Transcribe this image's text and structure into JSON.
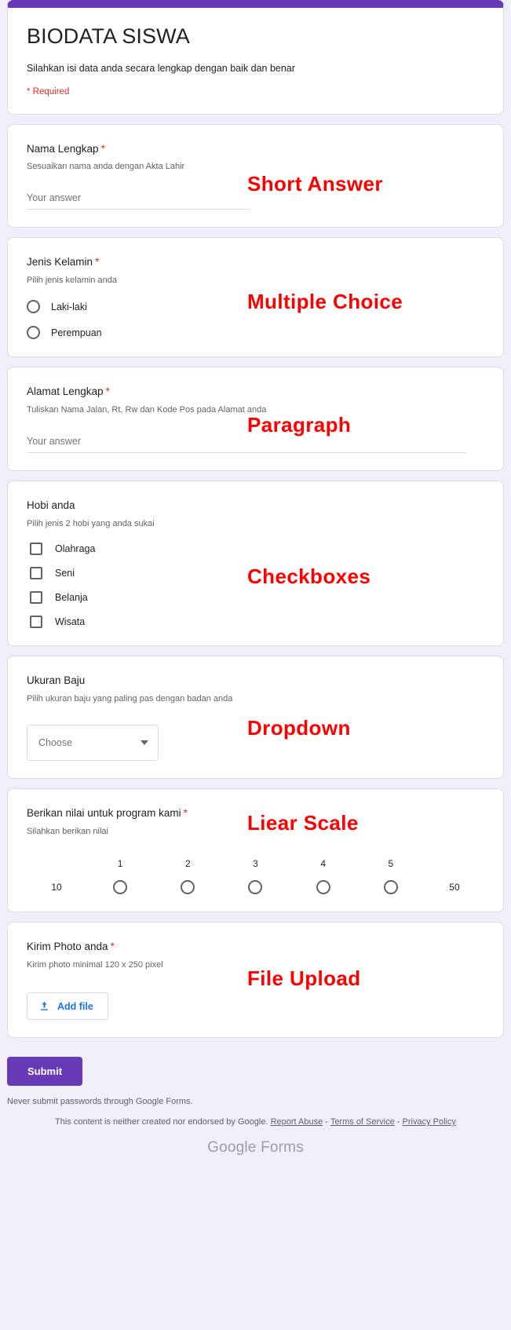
{
  "theme": {
    "accent": "#673ab7",
    "page_background": "#f0eef8",
    "card_background": "#ffffff",
    "required_red": "#d93025",
    "annotation_red": "#ff0000",
    "link_blue": "#1a73e8"
  },
  "header": {
    "title": "BIODATA SISWA",
    "description": "Silahkan isi data anda secara lengkap dengan baik dan benar",
    "required_note": "* Required"
  },
  "questions": [
    {
      "id": "nama-lengkap",
      "title": "Nama Lengkap",
      "required_mark": "*",
      "description": "Sesuaikan nama anda dengan Akta Lahir",
      "placeholder": "Your answer",
      "annotation": "Short Answer"
    },
    {
      "id": "jenis-kelamin",
      "title": "Jenis Kelamin",
      "required_mark": "*",
      "description": "Pilih jenis kelamin anda",
      "options": [
        "Laki-laki",
        "Perempuan"
      ],
      "annotation": "Multiple Choice"
    },
    {
      "id": "alamat-lengkap",
      "title": "Alamat Lengkap",
      "required_mark": "*",
      "description": "Tuliskan Nama Jalan, Rt, Rw dan Kode Pos pada Alamat anda",
      "placeholder": "Your answer",
      "annotation": "Paragraph"
    },
    {
      "id": "hobi-anda",
      "title": "Hobi anda",
      "required_mark": "",
      "description": "Pilih jenis 2 hobi yang anda sukai",
      "options": [
        "Olahraga",
        "Seni",
        "Belanja",
        "Wisata"
      ],
      "annotation": "Checkboxes"
    },
    {
      "id": "ukuran-baju",
      "title": "Ukuran Baju",
      "required_mark": "",
      "description": "Pilih ukuran baju yang paling pas dengan badan anda",
      "selected_value": "Choose",
      "annotation": "Dropdown"
    },
    {
      "id": "berikan-nilai",
      "title": "Berikan nilai untuk program kami",
      "required_mark": "*",
      "description": "Silahkan berikan nilai",
      "scale": {
        "points": [
          "1",
          "2",
          "3",
          "4",
          "5"
        ],
        "low_label": "10",
        "high_label": "50"
      },
      "annotation": "Liear Scale"
    },
    {
      "id": "kirim-photo",
      "title": "Kirim Photo anda",
      "required_mark": "*",
      "description": "Kirim photo minimal 120 x 250 pixel",
      "add_file_label": "Add file",
      "annotation": "File Upload"
    }
  ],
  "footer": {
    "submit_label": "Submit",
    "never_text": "Never submit passwords through Google Forms.",
    "disclaimer_prefix": "This content is neither created nor endorsed by Google.",
    "report_abuse": "Report Abuse",
    "terms": "Terms of Service",
    "privacy": "Privacy Policy",
    "separator": "-",
    "brand_google": "Google",
    "brand_forms": "Forms"
  },
  "icons": {
    "chevron_down": "chevron-down-icon",
    "upload": "upload-icon"
  }
}
